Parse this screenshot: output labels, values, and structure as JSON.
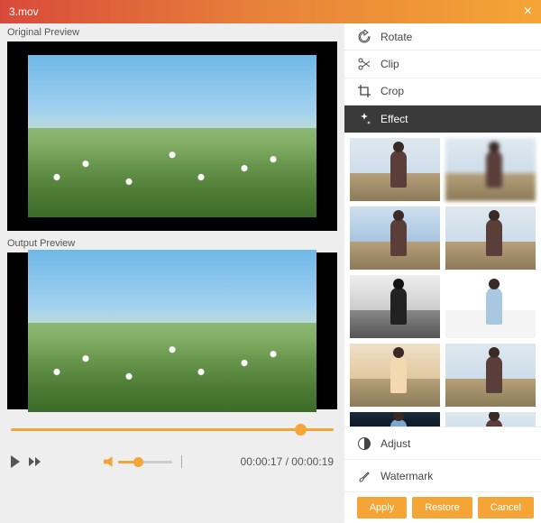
{
  "titlebar": {
    "filename": "3.mov"
  },
  "left": {
    "original_label": "Original Preview",
    "output_label": "Output Preview",
    "time_current": "00:00:17",
    "time_total": "00:00:19",
    "time_sep": " / "
  },
  "tools": {
    "rotate": "Rotate",
    "clip": "Clip",
    "crop": "Crop",
    "effect": "Effect",
    "adjust": "Adjust",
    "watermark": "Watermark"
  },
  "buttons": {
    "apply": "Apply",
    "restore": "Restore",
    "cancel": "Cancel"
  },
  "colors": {
    "accent": "#f5a536"
  }
}
